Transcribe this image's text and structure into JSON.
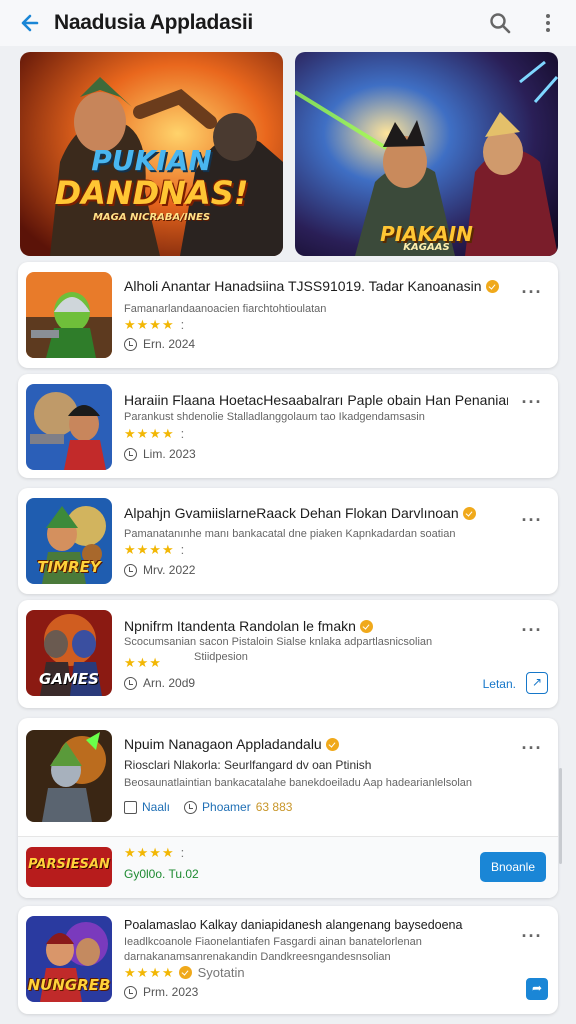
{
  "app": {
    "title": "Naadusia Appladasii"
  },
  "icons": {
    "back": "arrow-left-icon",
    "search": "search-icon",
    "menu": "more-vert-icon",
    "more": "more-horiz-icon",
    "clock": "clock-icon",
    "verified": "verified-badge-icon"
  },
  "colors": {
    "accent": "#1a86d6",
    "star": "#f2b705",
    "badge": "#f0a91b",
    "green": "#1f8b32"
  },
  "banners": [
    {
      "logo_main": "DANDNAS!",
      "logo_top": "PUKIAN",
      "logo_small": "MAGA NICRABA/INES"
    },
    {
      "logo_main": "PIAKAIN",
      "logo_small": "KAGAAS"
    }
  ],
  "list": [
    {
      "title": "Alholi Anantar Hanadsiina TJSS91019. Tadar Kanoanasin",
      "desc": "Famanarlandaanoacien fiarchtohtioulatan",
      "stars": "★★★★",
      "stars_extra": ":",
      "date": "Ern. 2024",
      "verified": true
    },
    {
      "title": "Haraiin Flaana HoetacHesaabalrarı Paple obain Han Penanian",
      "desc": "Parankust shdenolie Stalladlanggolaum tao Ikadgendamsasin",
      "stars": "★★★★",
      "stars_extra": ":",
      "date": "Lim. 2023",
      "verified": false
    },
    {
      "title": "Alpahjn GvamiislarneRaack Dehan Flokan Darvlınoan",
      "desc": "Pamanatanınhe manı bankacatal dne piaken Kapnkadardan soatian",
      "stars": "★★★★",
      "stars_extra": ":",
      "date": "Mrv. 2022",
      "verified": true,
      "thumb_label": "TIMREY"
    },
    {
      "title": "Npnifrm Itandenta Randolan le fmakn",
      "desc": "Scocumsanian sacon Pistaloin Sialse knlaka adpartlasnicsolian",
      "desc2": "Stiidpesion",
      "stars": "★★★",
      "stars_extra": "",
      "date": "Arn. 20d9",
      "verified": true,
      "thumb_label": "GAMES",
      "action": "Letan.",
      "action_icon": "external-link-icon"
    },
    {
      "title": "Npuim Nanagaon Appladandalu",
      "subtitle": "Riosclari Nlakorla: Seurlfangard dv oan Ptinish",
      "desc": "Beosaunatlaintian bankacatalahe banekdoeiladu Aap hadearianlelsolan",
      "meta1": "Naalı",
      "meta2_label": "Phoamer",
      "meta2_value": "63 883",
      "verified": true
    },
    {
      "title": "Poalamaslao Kalkay daniapidanesh alangenang baysedoena",
      "desc": "Ieadlkcoanole Fiaonelantiafen Fasgardi ainan banatelorlenan",
      "desc2": "darnakanamsanrenakandin Dandkreesngandesnsolian",
      "stars": "★★★★",
      "stars_extra": "Syotatin",
      "date": "Prm. 2023",
      "verified": true,
      "thumb_label": "NUNGREB",
      "action_icon": "share-icon"
    }
  ],
  "sub_item": {
    "thumb_label": "PARSIESAN",
    "stars": "★★★★",
    "stars_extra": ":",
    "value": "Gy0l0o. Tu.02",
    "button": "Bnoanle"
  }
}
